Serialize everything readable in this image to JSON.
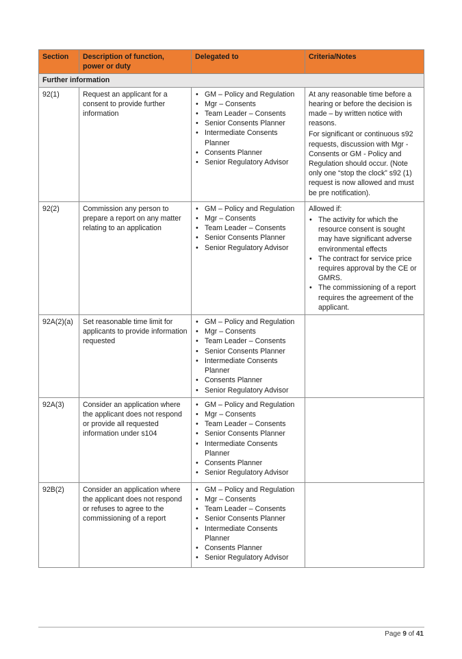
{
  "table": {
    "headers": [
      "Section",
      "Description of function, power or duty",
      "Delegated to",
      "Criteria/Notes"
    ],
    "group_label": "Further information",
    "rows": [
      {
        "section": "92(1)",
        "description": "Request an applicant for a consent to provide further information",
        "delegated_to": [
          "GM – Policy and Regulation",
          "Mgr – Consents",
          "Team Leader – Consents",
          "Senior Consents Planner",
          "Intermediate Consents Planner",
          "Consents Planner",
          "Senior Regulatory Advisor"
        ],
        "notes_paragraphs": [
          "At any reasonable time before a hearing or before the decision is made – by written notice with reasons.",
          "For significant or continuous s92 requests, discussion with Mgr - Consents or GM - Policy and Regulation should occur. (Note only one “stop the clock” s92 (1) request is now allowed and must be pre notification)."
        ]
      },
      {
        "section": "92(2)",
        "description": "Commission any person to prepare a report on any matter relating to an application",
        "delegated_to": [
          "GM – Policy and Regulation",
          "Mgr – Consents",
          "Team Leader – Consents",
          "Senior Consents Planner",
          "Senior Regulatory Advisor"
        ],
        "notes_intro": "Allowed if:",
        "notes_bullets": [
          "The activity for which the resource consent is sought may have significant adverse environmental effects",
          "The contract for service price requires approval by the CE or GMRS.",
          "The commissioning of a report requires the agreement of the applicant."
        ]
      },
      {
        "section": "92A(2)(a)",
        "description": "Set reasonable time limit for applicants to provide information requested",
        "delegated_to": [
          "GM – Policy and Regulation",
          "Mgr – Consents",
          "Team Leader – Consents",
          "Senior Consents Planner",
          "Intermediate Consents Planner",
          "Consents Planner",
          "Senior Regulatory Advisor"
        ]
      },
      {
        "section": "92A(3)",
        "description": "Consider an application where the applicant does not respond or provide all requested information under s104",
        "delegated_to": [
          "GM – Policy and Regulation",
          "Mgr – Consents",
          "Team Leader – Consents",
          "Senior Consents Planner",
          "Intermediate Consents Planner",
          "Consents Planner",
          "Senior Regulatory Advisor"
        ]
      },
      {
        "section": "92B(2)",
        "description": "Consider an application where the applicant does not respond or refuses to agree to the commissioning of a report",
        "delegated_to": [
          "GM – Policy and Regulation",
          "Mgr – Consents",
          "Team Leader – Consents",
          "Senior Consents Planner",
          "Intermediate Consents Planner",
          "Consents Planner",
          "Senior Regulatory Advisor"
        ]
      }
    ]
  },
  "footer": {
    "page_prefix": "Page",
    "page_current": "9",
    "page_of": "of",
    "page_total": "41"
  },
  "colors": {
    "header_bg": "#ed7d31",
    "section_bg": "#e7e6e6",
    "border": "#8c8c8c"
  }
}
